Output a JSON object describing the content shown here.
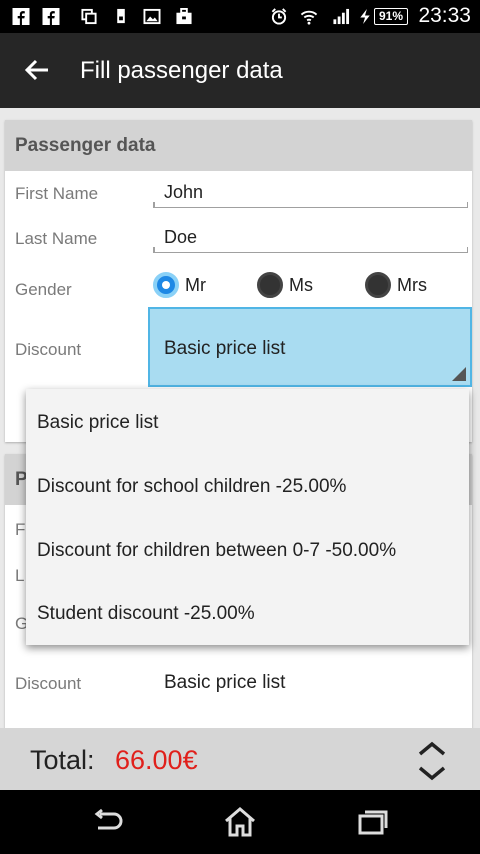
{
  "status": {
    "time": "23:33",
    "battery": "91%",
    "icons": [
      "facebook-icon",
      "facebook-icon",
      "copy-icon",
      "sim-icon",
      "image-icon",
      "briefcase-icon",
      "alarm-icon",
      "wifi-icon",
      "signal-icon",
      "charging-icon"
    ]
  },
  "header": {
    "title": "Fill passenger data",
    "back_icon": "arrow-left-icon"
  },
  "passenger1": {
    "section_title": "Passenger data",
    "first_name_label": "First Name",
    "first_name_value": "John",
    "last_name_label": "Last Name",
    "last_name_value": "Doe",
    "gender_label": "Gender",
    "gender_options": [
      "Mr",
      "Ms",
      "Mrs"
    ],
    "gender_selected": "Mr",
    "discount_label": "Discount",
    "discount_value": "Basic price list"
  },
  "passenger2": {
    "section_title_partial": "P",
    "first_name_label_partial": "F",
    "last_name_label_partial": "L",
    "gender_label_partial": "G",
    "discount_label": "Discount",
    "discount_value": "Basic price list"
  },
  "dropdown": {
    "options": [
      "Basic price list",
      "Discount for school children -25.00%",
      "Discount for children between 0-7 -50.00%",
      "Student discount -25.00%"
    ]
  },
  "total": {
    "label": "Total:",
    "value": "66.00€"
  },
  "colors": {
    "accent": "#50b5e5",
    "total": "#e0201b",
    "actionbar": "#262626"
  }
}
